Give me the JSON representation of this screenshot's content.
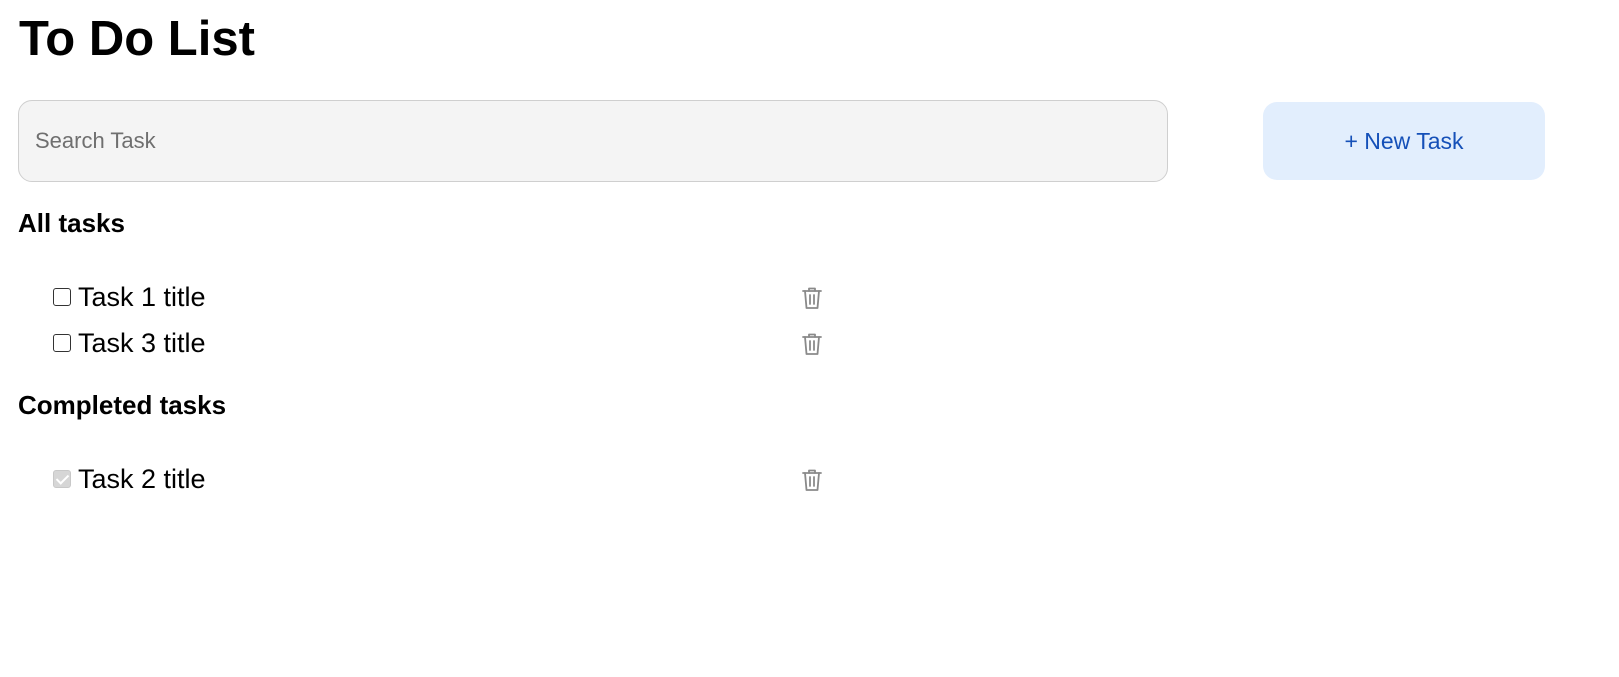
{
  "header": {
    "title": "To Do List"
  },
  "search": {
    "placeholder": "Search Task",
    "value": ""
  },
  "toolbar": {
    "new_task_label": "+ New Task"
  },
  "sections": {
    "all": {
      "heading": "All tasks",
      "tasks": [
        {
          "title": "Task 1 title",
          "completed": false,
          "icon": "trash-icon"
        },
        {
          "title": "Task 3 title",
          "completed": false,
          "icon": "trash-icon"
        }
      ]
    },
    "completed": {
      "heading": "Completed tasks",
      "tasks": [
        {
          "title": "Task 2 title",
          "completed": true,
          "icon": "trash-icon"
        }
      ]
    }
  },
  "colors": {
    "accent_text": "#1550b8",
    "accent_background": "#e2eefd",
    "search_background": "#f4f4f4",
    "icon_gray": "#8a8a8a"
  }
}
